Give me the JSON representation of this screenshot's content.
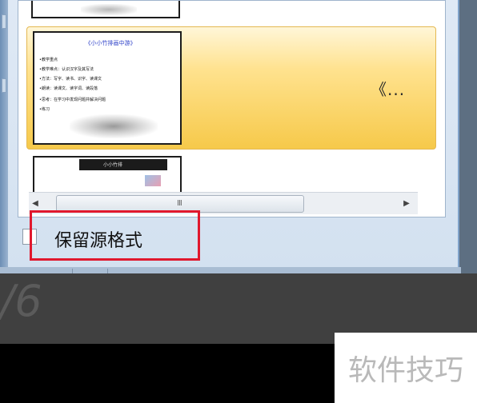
{
  "slides": {
    "selected": {
      "label": "《...",
      "title": "《小小竹排画中游》",
      "bullets": [
        "教学重点",
        "教学难点：认识汉字及其写法",
        "方法：写字、读书、识字、读课文",
        "朗读：读课文、读字词、读段落",
        "思考：在学习中发现问题并解决问题",
        "练习"
      ]
    },
    "next": {
      "header": "小小竹排"
    }
  },
  "scroll": {
    "grip": "III",
    "left_arrow": "◀",
    "right_arrow": "▶",
    "down_arrow": "▼"
  },
  "options": {
    "keep_source_formatting": "保留源格式",
    "checked": false
  },
  "background": {
    "page_fragment": "/6"
  },
  "watermark": {
    "text": "软件技巧"
  },
  "colors": {
    "selection": "#ffe28e",
    "highlight_box": "#e0182d",
    "chrome": "#4a7db8"
  }
}
